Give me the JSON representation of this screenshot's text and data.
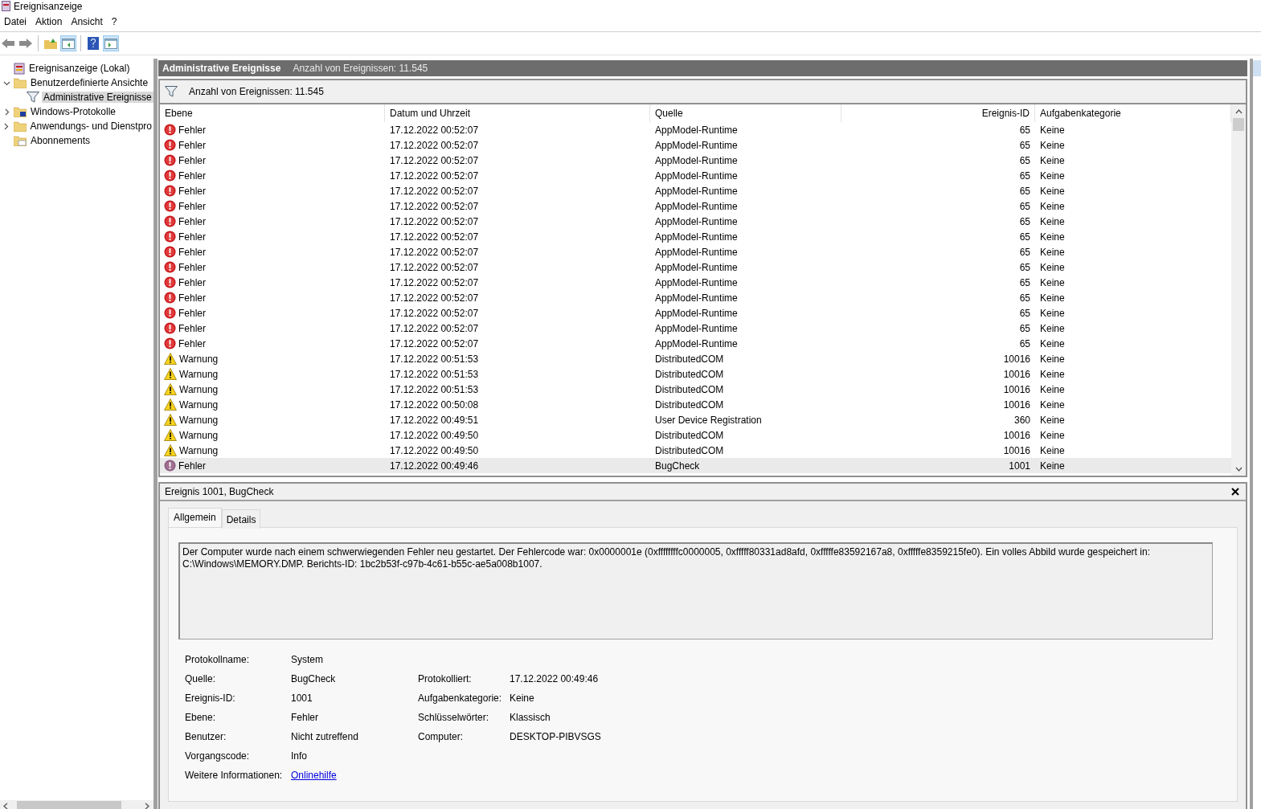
{
  "window": {
    "title": "Ereignisanzeige"
  },
  "menu": [
    "Datei",
    "Aktion",
    "Ansicht",
    "?"
  ],
  "toolbar": [
    {
      "kind": "back",
      "pressed": false
    },
    {
      "kind": "forward",
      "pressed": false
    },
    {
      "kind": "sep"
    },
    {
      "kind": "up",
      "pressed": false
    },
    {
      "kind": "tree",
      "pressed": true
    },
    {
      "kind": "sep"
    },
    {
      "kind": "help",
      "pressed": false
    },
    {
      "kind": "actions",
      "pressed": true
    }
  ],
  "tree": [
    {
      "label": "Ereignisanzeige (Lokal)",
      "kind": "root",
      "selected": false,
      "children": [
        {
          "label": "Benutzerdefinierte Ansichte",
          "kind": "folder",
          "expanded": true,
          "selected": false,
          "children": [
            {
              "label": "Administrative Ereignisse",
              "kind": "filter",
              "selected": true
            }
          ]
        },
        {
          "label": "Windows-Protokolle",
          "kind": "logs",
          "expanded": false,
          "selected": false
        },
        {
          "label": "Anwendungs- und Dienstpro",
          "kind": "folder",
          "expanded": false,
          "selected": false
        },
        {
          "label": "Abonnements",
          "kind": "subs",
          "selected": false
        }
      ]
    }
  ],
  "header": {
    "title": "Administrative Ereignisse",
    "count": "Anzahl von Ereignissen: 11.545"
  },
  "filter": {
    "text": "Anzahl von Ereignissen: 11.545"
  },
  "table": {
    "columns": [
      "Ebene",
      "Datum und Uhrzeit",
      "Quelle",
      "Ereignis-ID",
      "Aufgabenkategorie"
    ],
    "rows": [
      {
        "kind": "error",
        "level": "Fehler",
        "date": "17.12.2022 00:52:07",
        "source": "AppModel-Runtime",
        "id": "65",
        "category": "Keine",
        "selected": false
      },
      {
        "kind": "error",
        "level": "Fehler",
        "date": "17.12.2022 00:52:07",
        "source": "AppModel-Runtime",
        "id": "65",
        "category": "Keine",
        "selected": false
      },
      {
        "kind": "error",
        "level": "Fehler",
        "date": "17.12.2022 00:52:07",
        "source": "AppModel-Runtime",
        "id": "65",
        "category": "Keine",
        "selected": false
      },
      {
        "kind": "error",
        "level": "Fehler",
        "date": "17.12.2022 00:52:07",
        "source": "AppModel-Runtime",
        "id": "65",
        "category": "Keine",
        "selected": false
      },
      {
        "kind": "error",
        "level": "Fehler",
        "date": "17.12.2022 00:52:07",
        "source": "AppModel-Runtime",
        "id": "65",
        "category": "Keine",
        "selected": false
      },
      {
        "kind": "error",
        "level": "Fehler",
        "date": "17.12.2022 00:52:07",
        "source": "AppModel-Runtime",
        "id": "65",
        "category": "Keine",
        "selected": false
      },
      {
        "kind": "error",
        "level": "Fehler",
        "date": "17.12.2022 00:52:07",
        "source": "AppModel-Runtime",
        "id": "65",
        "category": "Keine",
        "selected": false
      },
      {
        "kind": "error",
        "level": "Fehler",
        "date": "17.12.2022 00:52:07",
        "source": "AppModel-Runtime",
        "id": "65",
        "category": "Keine",
        "selected": false
      },
      {
        "kind": "error",
        "level": "Fehler",
        "date": "17.12.2022 00:52:07",
        "source": "AppModel-Runtime",
        "id": "65",
        "category": "Keine",
        "selected": false
      },
      {
        "kind": "error",
        "level": "Fehler",
        "date": "17.12.2022 00:52:07",
        "source": "AppModel-Runtime",
        "id": "65",
        "category": "Keine",
        "selected": false
      },
      {
        "kind": "error",
        "level": "Fehler",
        "date": "17.12.2022 00:52:07",
        "source": "AppModel-Runtime",
        "id": "65",
        "category": "Keine",
        "selected": false
      },
      {
        "kind": "error",
        "level": "Fehler",
        "date": "17.12.2022 00:52:07",
        "source": "AppModel-Runtime",
        "id": "65",
        "category": "Keine",
        "selected": false
      },
      {
        "kind": "error",
        "level": "Fehler",
        "date": "17.12.2022 00:52:07",
        "source": "AppModel-Runtime",
        "id": "65",
        "category": "Keine",
        "selected": false
      },
      {
        "kind": "error",
        "level": "Fehler",
        "date": "17.12.2022 00:52:07",
        "source": "AppModel-Runtime",
        "id": "65",
        "category": "Keine",
        "selected": false
      },
      {
        "kind": "error",
        "level": "Fehler",
        "date": "17.12.2022 00:52:07",
        "source": "AppModel-Runtime",
        "id": "65",
        "category": "Keine",
        "selected": false
      },
      {
        "kind": "warning",
        "level": "Warnung",
        "date": "17.12.2022 00:51:53",
        "source": "DistributedCOM",
        "id": "10016",
        "category": "Keine",
        "selected": false
      },
      {
        "kind": "warning",
        "level": "Warnung",
        "date": "17.12.2022 00:51:53",
        "source": "DistributedCOM",
        "id": "10016",
        "category": "Keine",
        "selected": false
      },
      {
        "kind": "warning",
        "level": "Warnung",
        "date": "17.12.2022 00:51:53",
        "source": "DistributedCOM",
        "id": "10016",
        "category": "Keine",
        "selected": false
      },
      {
        "kind": "warning",
        "level": "Warnung",
        "date": "17.12.2022 00:50:08",
        "source": "DistributedCOM",
        "id": "10016",
        "category": "Keine",
        "selected": false
      },
      {
        "kind": "warning",
        "level": "Warnung",
        "date": "17.12.2022 00:49:51",
        "source": "User Device Registration",
        "id": "360",
        "category": "Keine",
        "selected": false
      },
      {
        "kind": "warning",
        "level": "Warnung",
        "date": "17.12.2022 00:49:50",
        "source": "DistributedCOM",
        "id": "10016",
        "category": "Keine",
        "selected": false
      },
      {
        "kind": "warning",
        "level": "Warnung",
        "date": "17.12.2022 00:49:50",
        "source": "DistributedCOM",
        "id": "10016",
        "category": "Keine",
        "selected": false
      },
      {
        "kind": "error",
        "level": "Fehler",
        "date": "17.12.2022 00:49:46",
        "source": "BugCheck",
        "id": "1001",
        "category": "Keine",
        "selected": true
      }
    ]
  },
  "detail": {
    "title": "Ereignis 1001, BugCheck",
    "tabs": [
      {
        "label": "Allgemein",
        "selected": true
      },
      {
        "label": "Details",
        "selected": false
      }
    ],
    "message": "Der Computer wurde nach einem schwerwiegenden Fehler neu gestartet. Der Fehlercode war: 0x0000001e (0xffffffffc0000005, 0xfffff80331ad8afd, 0xfffffe83592167a8, 0xfffffe8359215fe0). Ein volles Abbild wurde gespeichert in: C:\\Windows\\MEMORY.DMP. Berichts-ID: 1bc2b53f-c97b-4c61-b55c-ae5a008b1007.",
    "fields": [
      {
        "label": "Protokollname:",
        "value": "System"
      },
      {
        "label": "Quelle:",
        "value": "BugCheck",
        "label2": "Protokolliert:",
        "value2": "17.12.2022 00:49:46"
      },
      {
        "label": "Ereignis-ID:",
        "value": "1001",
        "label2": "Aufgabenkategorie:",
        "value2": "Keine"
      },
      {
        "label": "Ebene:",
        "value": "Fehler",
        "label2": "Schlüsselwörter:",
        "value2": "Klassisch"
      },
      {
        "label": "Benutzer:",
        "value": "Nicht zutreffend",
        "label2": "Computer:",
        "value2": "DESKTOP-PIBVSGS"
      },
      {
        "label": "Vorgangscode:",
        "value": "Info"
      },
      {
        "label": "Weitere Informationen:",
        "value": "Onlinehilfe",
        "kind": "link"
      }
    ]
  }
}
